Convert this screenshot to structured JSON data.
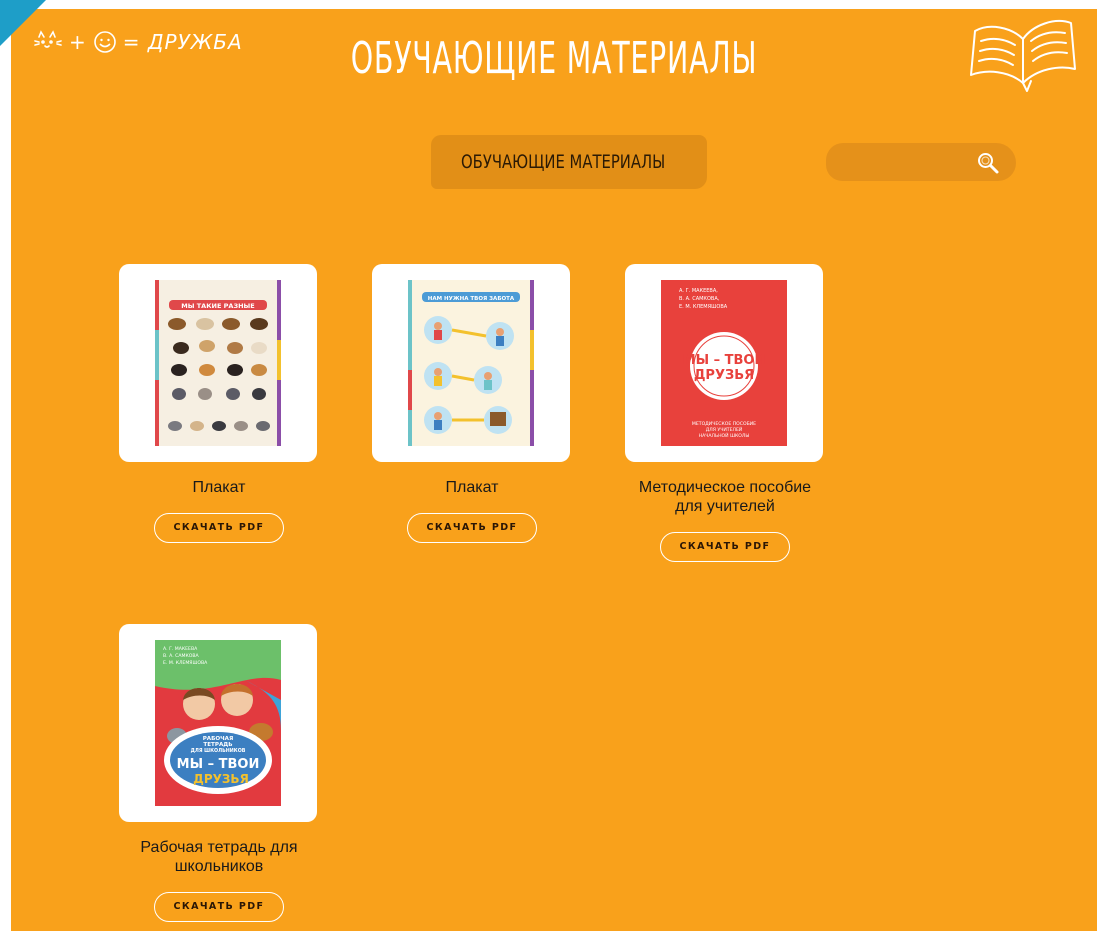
{
  "header": {
    "logo_text": "= ДРУЖБА",
    "logo_plus": "+",
    "title": "ОБУЧАЮЩИЕ МАТЕРИАЛЫ"
  },
  "nav": {
    "active_label": "ОБУЧАЮЩИЕ МАТЕРИАЛЫ",
    "icon": "bird-icon"
  },
  "search": {
    "value": "",
    "icon": "search-icon"
  },
  "materials": [
    {
      "title": "Плакат",
      "button": "СКАЧАТЬ PDF",
      "poster_heading": "МЫ ТАКИЕ РАЗНЫЕ"
    },
    {
      "title": "Плакат",
      "button": "СКАЧАТЬ PDF",
      "poster_heading": "НАМ НУЖНА ТВОЯ ЗАБОТА"
    },
    {
      "title": "Методическое пособие для учителей",
      "button": "СКАЧАТЬ PDF",
      "cover": {
        "authors": [
          "А. Г. МАКЕЕВА,",
          "В. А. САМКОВА,",
          "Е. М. КЛЕМЯШОВА"
        ],
        "title_line1": "МЫ – ТВОИ",
        "title_line2": "ДРУЗЬЯ",
        "subtitle": [
          "МЕТОДИЧЕСКОЕ ПОСОБИЕ",
          "ДЛЯ УЧИТЕЛЕЙ",
          "НАЧАЛЬНОЙ ШКОЛЫ"
        ]
      }
    },
    {
      "title": "Рабочая тетрадь для школьников",
      "button": "СКАЧАТЬ PDF",
      "cover": {
        "authors": [
          "А. Г. МАКЕЕВА",
          "В. А. САМКОВА",
          "Е. М. КЛЕМЯШОВА"
        ],
        "kicker": [
          "РАБОЧАЯ",
          "ТЕТРАДЬ",
          "ДЛЯ ШКОЛЬНИКОВ"
        ],
        "title_line1": "МЫ – ТВОИ",
        "title_line2": "ДРУЗЬЯ"
      }
    }
  ],
  "colors": {
    "background": "#f9a11b",
    "accent_dark": "#e28f17",
    "corner": "#1e9ec8",
    "cover_red": "#e8413c"
  }
}
